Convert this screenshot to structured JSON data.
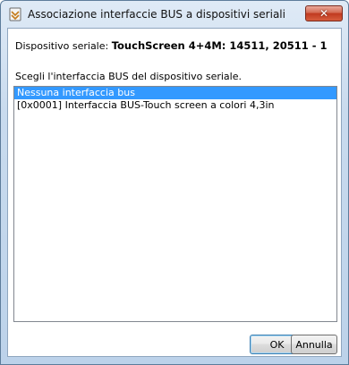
{
  "window": {
    "title": "Associazione interfaccie BUS a dispositivi seriali",
    "close_label": "✕"
  },
  "device": {
    "label": "Dispositivo seriale:",
    "value": "TouchScreen 4+4M: 14511, 20511 - 1"
  },
  "instruction": "Scegli l'interfaccia BUS del dispositivo seriale.",
  "list": {
    "items": [
      "Nessuna interfaccia bus",
      "[0x0001] Interfaccia BUS-Touch screen a colori 4,3in"
    ]
  },
  "buttons": {
    "ok": "OK",
    "cancel": "Annulla"
  },
  "colors": {
    "selection": "#3399ff",
    "close_button": "#c0391f"
  },
  "icons": {
    "title": "app-icon",
    "close": "close-icon"
  }
}
